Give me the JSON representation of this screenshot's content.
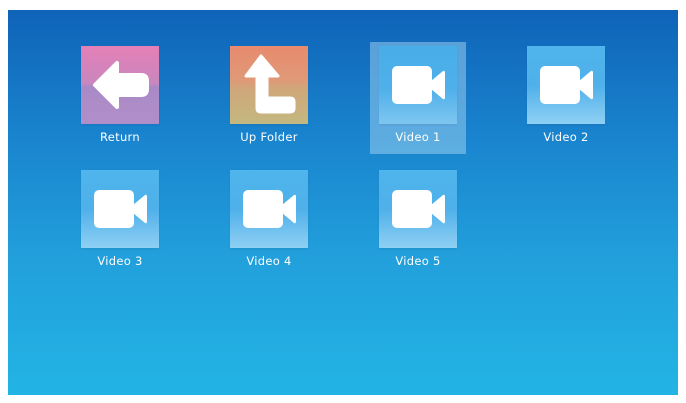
{
  "items": [
    {
      "label": "Return",
      "icon": "return-arrow-icon"
    },
    {
      "label": "Up Folder",
      "icon": "up-folder-arrow-icon"
    },
    {
      "label": "Video 1",
      "icon": "video-camera-icon",
      "selected": true
    },
    {
      "label": "Video 2",
      "icon": "video-camera-icon"
    },
    {
      "label": "Video 3",
      "icon": "video-camera-icon"
    },
    {
      "label": "Video 4",
      "icon": "video-camera-icon"
    },
    {
      "label": "Video 5",
      "icon": "video-camera-icon"
    }
  ],
  "colors": {
    "background_top": "#0f63b8",
    "background_bottom": "#22b4e4",
    "selection": "#96cdf0",
    "video_icon": "#4fb5ec",
    "return_icon": "#e57fb8",
    "up_icon": "#e88a6e"
  }
}
